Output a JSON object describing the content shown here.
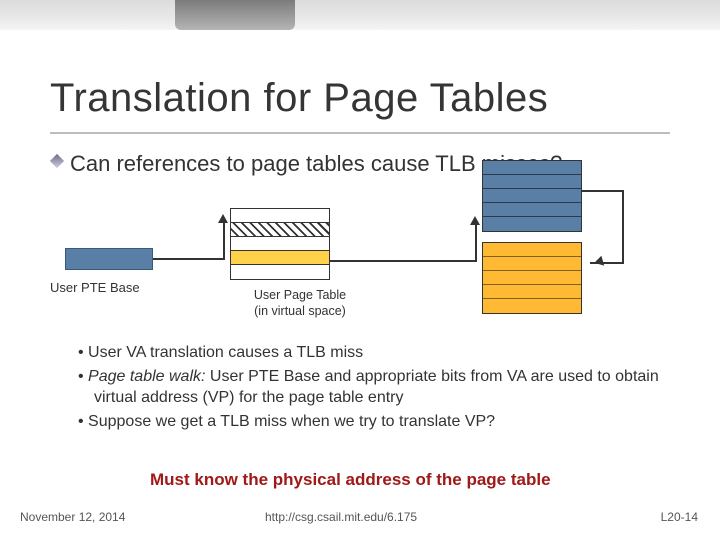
{
  "title": "Translation for Page Tables",
  "bullet_main": "Can references to page tables cause TLB misses?",
  "diagram": {
    "pte_base_label": "User PTE Base",
    "user_page_table_label": "User Page Table\n(in virtual space)"
  },
  "bullets": [
    {
      "text": "User VA translation causes a TLB miss"
    },
    {
      "prefix": "Page table walk:",
      "text": " User PTE Base and appropriate bits from VA are used to obtain virtual address (VP) for the page table entry"
    },
    {
      "text": "Suppose we get a TLB miss when we try to translate VP?"
    }
  ],
  "conclusion": "Must know the physical address of the page table",
  "footer": {
    "date": "November 12, 2014",
    "url": "http://csg.csail.mit.edu/6.175",
    "page": "L20-14"
  }
}
